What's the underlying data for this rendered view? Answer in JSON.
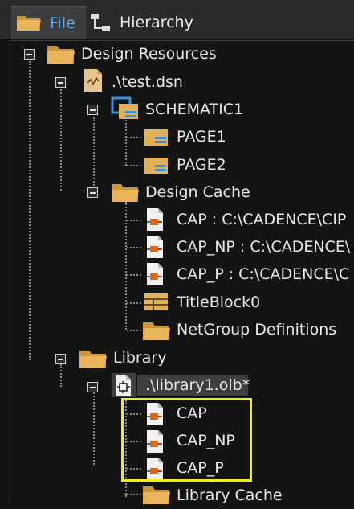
{
  "tabs": [
    {
      "label": "File",
      "icon": "folder-icon",
      "active": true
    },
    {
      "label": "Hierarchy",
      "icon": "hierarchy-icon",
      "active": false
    }
  ],
  "tree": {
    "design_resources": "Design Resources",
    "test_dsn": ".\\test.dsn",
    "schematic1": "SCHEMATIC1",
    "page1": "PAGE1",
    "page2": "PAGE2",
    "design_cache": "Design Cache",
    "cap_cache": "CAP : C:\\CADENCE\\CIP",
    "cap_np_cache": "CAP_NP : C:\\CADENCE\\",
    "cap_p_cache": "CAP_P : C:\\CADENCE\\C",
    "titleblock0": "TitleBlock0",
    "netgroup_definitions": "NetGroup Definitions",
    "library": "Library",
    "library1_olb": ".\\library1.olb*",
    "lib_cap": "CAP",
    "lib_cap_np": "CAP_NP",
    "lib_cap_p": "CAP_P",
    "library_cache": "Library Cache"
  },
  "colors": {
    "background": "#141414",
    "active_tab_text": "#57aef0",
    "highlight": "#ecec2c",
    "folder": "#e0b25a",
    "schematic_blue": "#3a8fd8"
  }
}
